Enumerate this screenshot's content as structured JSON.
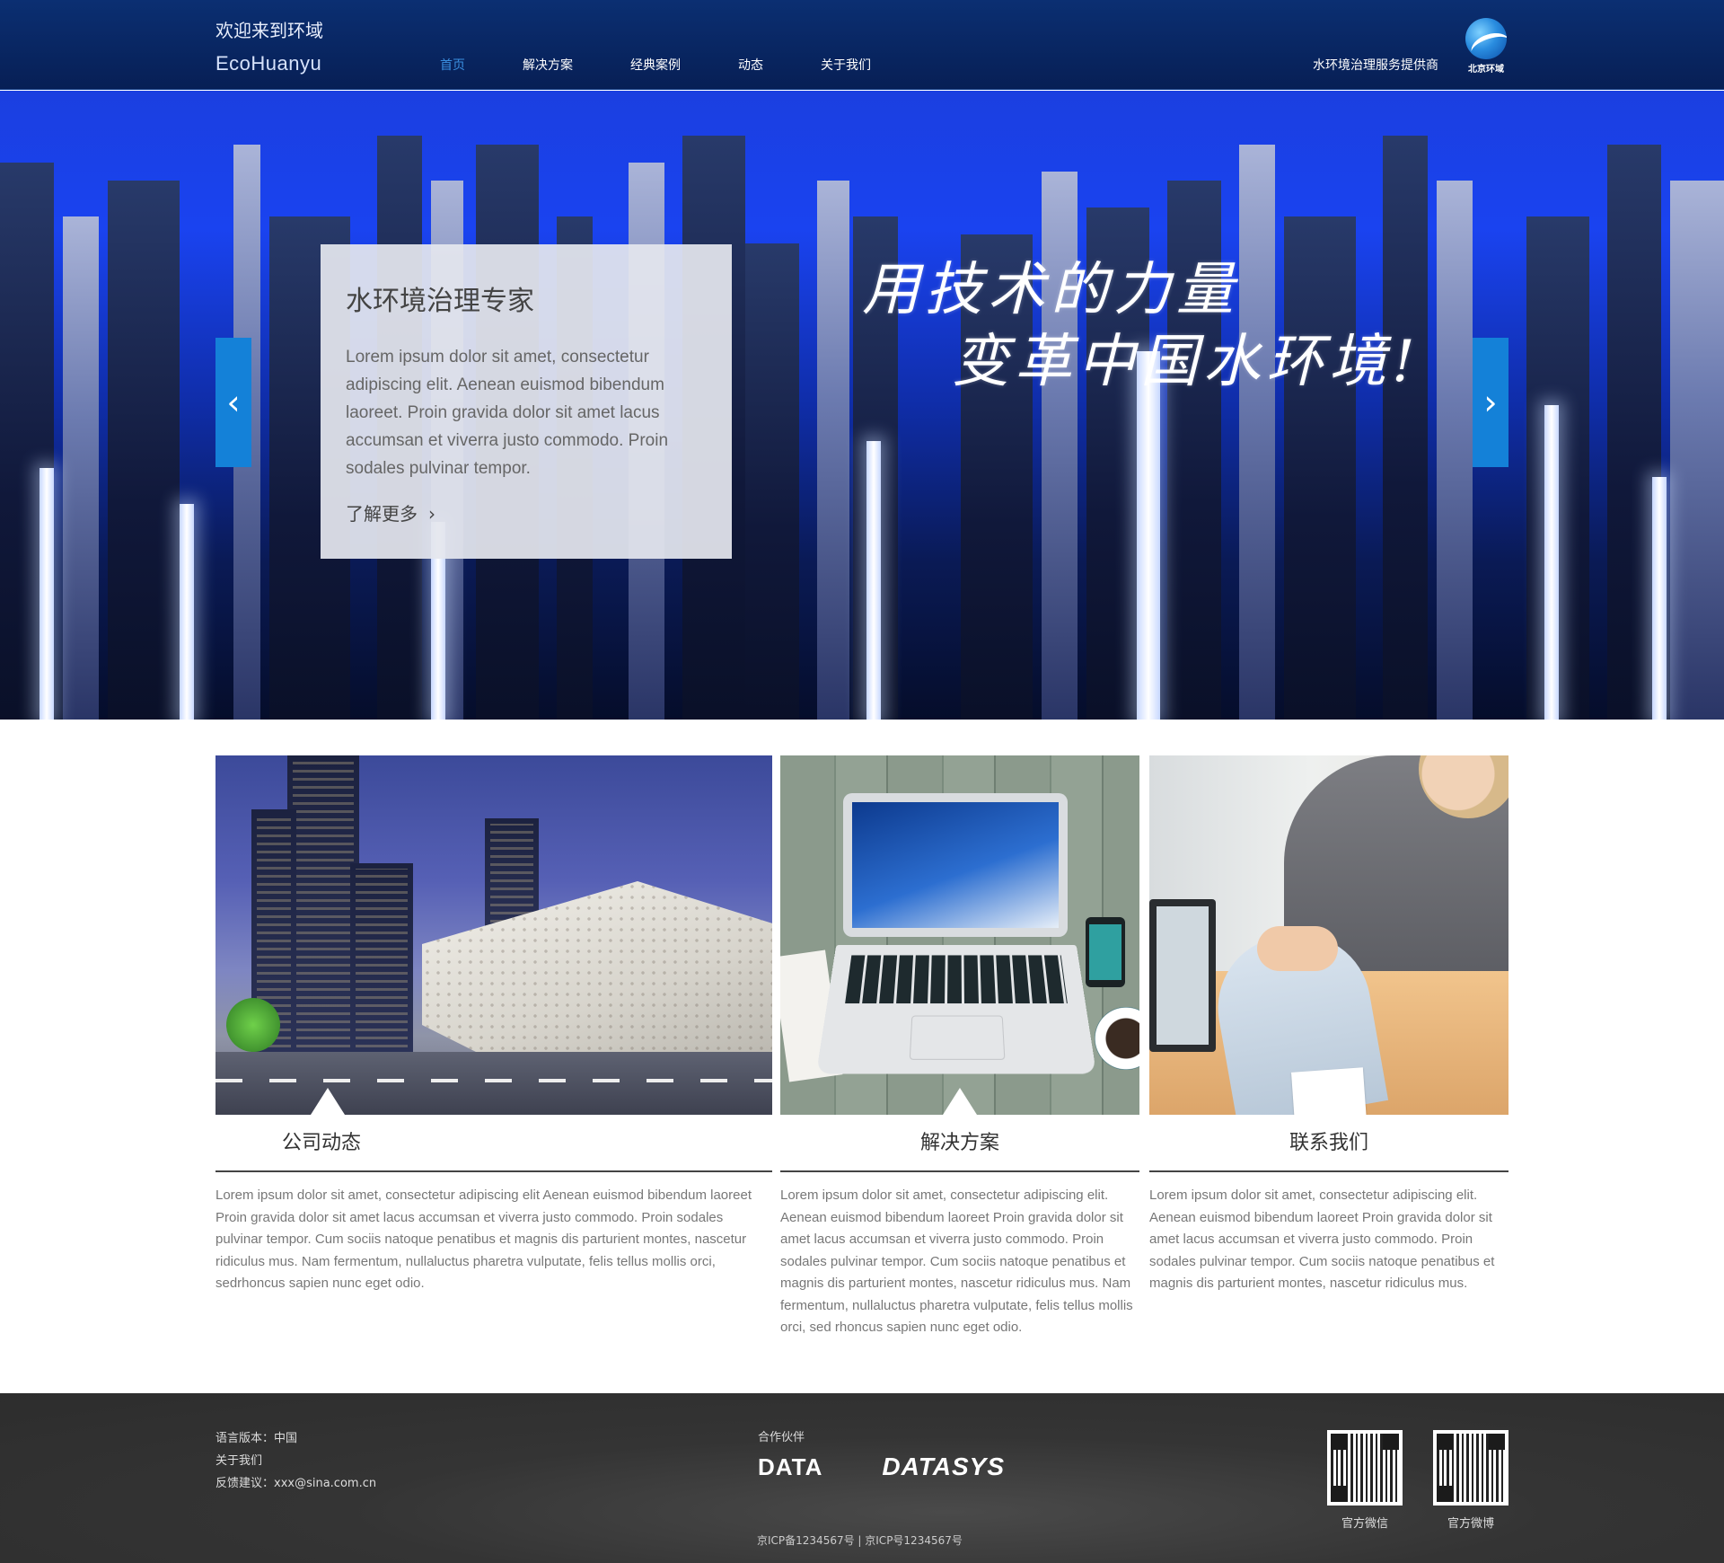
{
  "header": {
    "welcome": "欢迎来到环域",
    "brand": "EcoHuanyu",
    "nav": [
      {
        "label": "首页",
        "active": true
      },
      {
        "label": "解决方案",
        "active": false
      },
      {
        "label": "经典案例",
        "active": false
      },
      {
        "label": "动态",
        "active": false
      },
      {
        "label": "关于我们",
        "active": false
      }
    ],
    "tagline": "水环境治理服务提供商",
    "logo_text": "北京环域",
    "nav_active_color": "#3a8fe0"
  },
  "hero": {
    "card_title": "水环境治理专家",
    "card_text": "Lorem ipsum dolor sit amet, consectetur adipiscing elit. Aenean euismod bibendum laoreet. Proin gravida dolor sit amet lacus accumsan et viverra justo commodo. Proin sodales pulvinar tempor.",
    "more_label": "了解更多",
    "more_icon": "chevron-right-icon",
    "slogan_line1": "用技术的力量",
    "slogan_line2": "变革中国水环境!",
    "prev_icon": "chevron-left-icon",
    "next_icon": "chevron-right-icon",
    "arrow_color": "#1481d8"
  },
  "cards": [
    {
      "title": "公司动态",
      "text": "Lorem ipsum  dolor  sit  amet, consectetur adipiscing elit Aenean euismod bibendum laoreet Proin gravida dolor sit amet lacus accumsan et viverra justo commodo. Proin sodales pulvinar tempor. Cum sociis natoque penatibus et magnis dis parturient montes, nascetur ridiculus mus. Nam fermentum, nullaluctus pharetra vulputate, felis tellus mollis orci, sedrhoncus sapien nunc eget odio."
    },
    {
      "title": "解决方案",
      "text": "Lorem ipsum dolor sit amet, consectetur adipiscing elit. Aenean euismod bibendum laoreet Proin gravida dolor sit amet lacus accumsan et viverra justo commodo. Proin sodales pulvinar tempor. Cum sociis natoque penatibus et magnis dis parturient montes, nascetur ridiculus mus. Nam fermentum, nullaluctus pharetra vulputate, felis tellus mollis orci, sed rhoncus sapien nunc eget odio."
    },
    {
      "title": "联系我们",
      "text": "Lorem ipsum dolor sit amet, consectetur adipiscing elit. Aenean euismod bibendum laoreet Proin gravida dolor sit amet lacus accumsan et viverra justo commodo. Proin sodales pulvinar tempor. Cum sociis natoque penatibus et magnis dis parturient montes, nascetur ridiculus mus."
    }
  ],
  "footer": {
    "language": "语言版本：中国",
    "about": "关于我们",
    "feedback": "反馈建议：xxx@sina.com.cn",
    "partners_label": "合作伙伴",
    "partner1": "DATA",
    "partner2": "DATASYS",
    "icp": "京ICP备1234567号 | 京ICP号1234567号",
    "qr1_label": "官方微信",
    "qr2_label": "官方微博"
  }
}
